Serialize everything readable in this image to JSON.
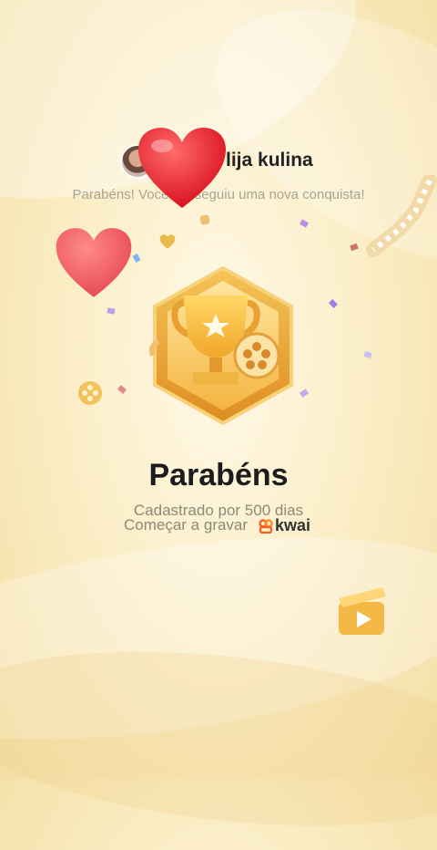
{
  "header": {
    "username": "lija kulina",
    "subtitle": "Parabéns! Você conseguiu uma nova conquista!"
  },
  "achievement": {
    "title": "Parabéns",
    "description": "Cadastrado por 500 dias",
    "cta_text": "Começar a gravar",
    "brand": "kwai"
  },
  "icons": [
    "avatar",
    "heart-icon",
    "trophy-badge-icon",
    "film-reel-icon",
    "clapperboard-icon",
    "kwai-logo-icon"
  ],
  "colors": {
    "background": "#fbefc9",
    "badge_gold": "#e9a63a",
    "heart_red": "#e8262f",
    "kwai_orange": "#ff5a1f"
  }
}
